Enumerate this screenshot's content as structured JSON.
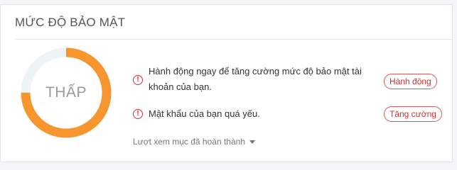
{
  "panel": {
    "title": "MỨC ĐỘ BẢO MẬT"
  },
  "gauge": {
    "level_label": "THẤP",
    "level_fraction": 0.75,
    "filled_color": "#f7962f",
    "track_color": "#eef3f5"
  },
  "alerts": [
    {
      "icon": "alert-circle-icon",
      "text": "Hành động ngay để tăng cường mức độ bảo mật tài khoản của bạn.",
      "button_label": "Hành động"
    },
    {
      "icon": "alert-circle-icon",
      "text": "Mật khẩu của bạn quá yếu.",
      "button_label": "Tăng cường"
    }
  ],
  "completed_items": {
    "label": "Lượt xem mục đã hoàn thành",
    "icon": "caret-down-icon"
  },
  "colors": {
    "alert_red": "#d32f2f",
    "gauge_orange": "#f7962f"
  }
}
